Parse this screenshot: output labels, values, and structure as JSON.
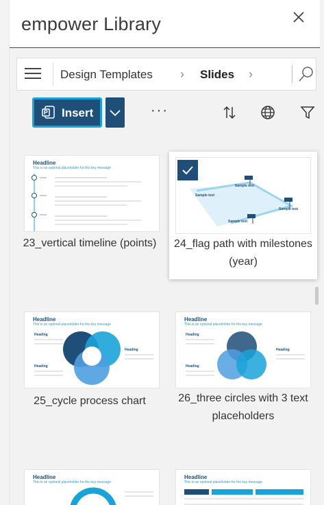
{
  "window": {
    "title": "empower Library",
    "close_icon": "close-icon"
  },
  "nav": {
    "menu_icon": "hamburger-menu-icon",
    "breadcrumb": [
      "Design Templates",
      "Slides"
    ],
    "search_icon": "search-icon"
  },
  "toolbar": {
    "insert_label": "Insert",
    "more_label": "···",
    "sort_icon": "sort-icon",
    "language_icon": "globe-icon",
    "filter_icon": "filter-icon"
  },
  "colors": {
    "accent": "#1f4e79",
    "highlight": "#1aa3d9"
  },
  "thumbs": {
    "headline": "Headline",
    "subline": "This is an optional placeholder for the key message",
    "text": "Text",
    "heading": "Heading",
    "sample_text": "Sample text"
  },
  "templates": [
    {
      "caption": "23_vertical timeline (points)",
      "selected": false
    },
    {
      "caption": "24_flag path with milestones (year)",
      "selected": true
    },
    {
      "caption": "25_cycle process chart",
      "selected": false
    },
    {
      "caption": "26_three circles with 3 text placeholders",
      "selected": false
    },
    {
      "caption": "",
      "selected": false
    },
    {
      "caption": "",
      "selected": false
    }
  ]
}
